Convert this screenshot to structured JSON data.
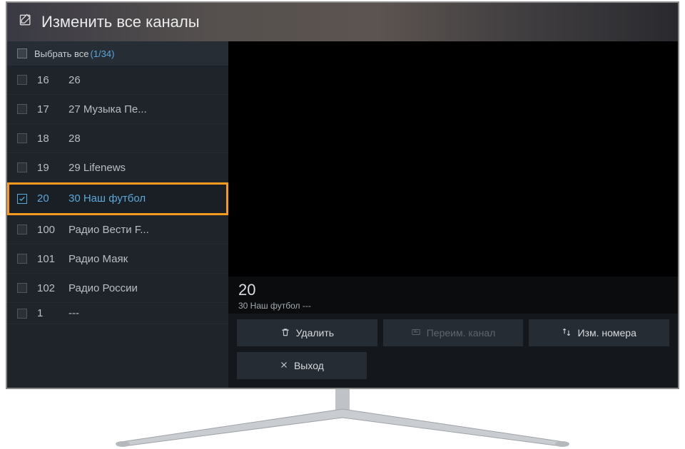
{
  "header": {
    "title": "Изменить все каналы"
  },
  "selectAll": {
    "label": "Выбрать все",
    "count": "(1/34)"
  },
  "channels": [
    {
      "num": "16",
      "name": "26",
      "checked": false,
      "selected": false
    },
    {
      "num": "17",
      "name": "27 Музыка Пе...",
      "checked": false,
      "selected": false
    },
    {
      "num": "18",
      "name": "28",
      "checked": false,
      "selected": false
    },
    {
      "num": "19",
      "name": "29 Lifenews",
      "checked": false,
      "selected": false
    },
    {
      "num": "20",
      "name": "30 Наш футбол",
      "checked": true,
      "selected": true
    },
    {
      "num": "100",
      "name": "Радио Вести F...",
      "checked": false,
      "selected": false
    },
    {
      "num": "101",
      "name": "Радио Маяк",
      "checked": false,
      "selected": false
    },
    {
      "num": "102",
      "name": "Радио России",
      "checked": false,
      "selected": false
    },
    {
      "num": "1",
      "name": "---",
      "checked": false,
      "selected": false
    }
  ],
  "detail": {
    "number": "20",
    "name": "30 Наш футбол ---"
  },
  "buttons": {
    "delete": "Удалить",
    "rename": "Переим. канал",
    "renumber": "Изм. номера",
    "exit": "Выход"
  }
}
